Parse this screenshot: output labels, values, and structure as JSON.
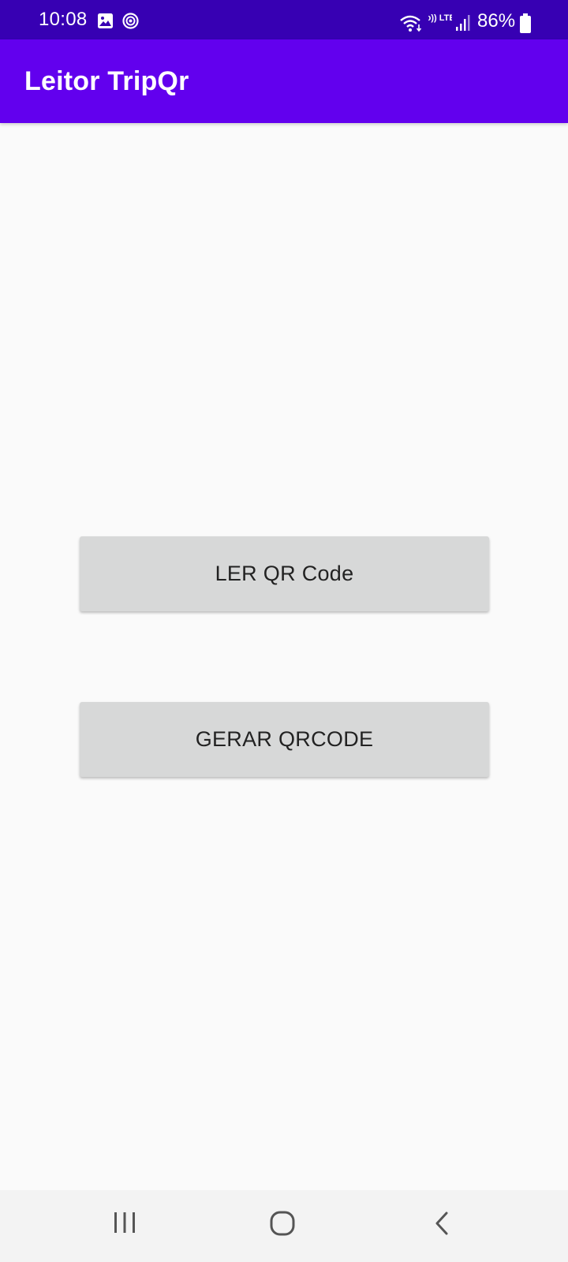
{
  "status_bar": {
    "time": "10:08",
    "battery_percent": "86%",
    "network_label": "Vo)) LTE1",
    "icons": [
      "gallery-icon",
      "target-icon",
      "wifi-icon",
      "volte-lte-icon",
      "signal-icon",
      "battery-icon"
    ],
    "background_color": "#3700b3"
  },
  "app_bar": {
    "title": "Leitor TripQr",
    "background_color": "#6200ee"
  },
  "main": {
    "buttons": [
      {
        "label": "LER QR Code"
      },
      {
        "label": "GERAR QRCODE"
      }
    ],
    "button_color": "#d7d8d8",
    "background_color": "#fafafa"
  },
  "nav_bar": {
    "icons": [
      "recent-apps-icon",
      "home-icon",
      "back-icon"
    ]
  }
}
